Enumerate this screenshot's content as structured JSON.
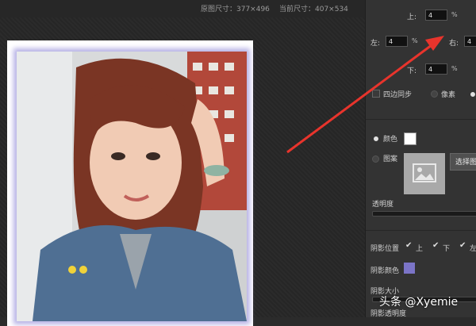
{
  "topbar": {
    "original_size": "原图尺寸：377×496",
    "current_size": "当前尺寸：407×534"
  },
  "border_panel": {
    "top_label": "上:",
    "top_value": "4",
    "left_label": "左:",
    "left_value": "4",
    "right_label": "右:",
    "right_value": "4",
    "bottom_label": "下:",
    "bottom_value": "4",
    "unit": "%",
    "sync_label": "四边同步",
    "pixel_label": "像素"
  },
  "fill": {
    "color_label": "颜色",
    "pattern_label": "图案",
    "select_button": "选择图",
    "opacity_label": "透明度",
    "color_swatch": "#ffffff"
  },
  "shadow": {
    "position_label": "阴影位置",
    "pos_top": "上",
    "pos_bottom": "下",
    "pos_left": "左",
    "color_label": "阴影颜色",
    "color_swatch": "#7b74c7",
    "size_label": "阴影大小",
    "opacity_label": "阴影透明度"
  },
  "watermark": "头条 @Xyemie",
  "colors": {
    "arrow": "#e8342c",
    "glow": "#b7b2e6"
  }
}
